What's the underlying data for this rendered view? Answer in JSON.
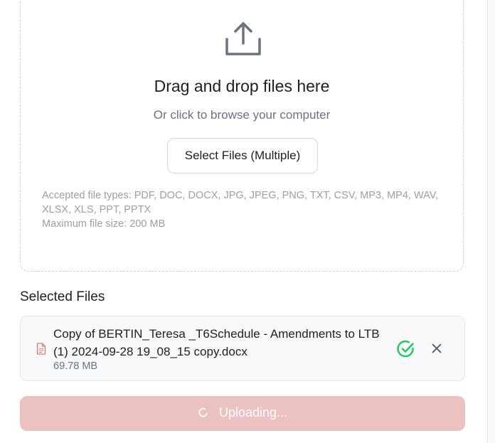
{
  "dropzone": {
    "title": "Drag and drop files here",
    "subtitle": "Or click to browse your computer",
    "select_button_label": "Select Files (Multiple)",
    "accepted_types_line1": "Accepted file types: PDF, DOC, DOCX, JPG, JPEG, PNG, TXT, CSV, MP3, MP4, WAV,",
    "accepted_types_line2": "XLSX, XLS, PPT, PPTX",
    "max_size": "Maximum file size: 200 MB",
    "icon": "upload-icon"
  },
  "selected_files": {
    "title": "Selected Files",
    "files": [
      {
        "name": "Copy of BERTIN_Teresa _T6Schedule - Amendments to LTB (1) 2024-09-28 19_08_15 copy.docx",
        "size": "69.78 MB",
        "status": "complete",
        "icons": [
          "document-icon",
          "check-circle-icon",
          "close-icon"
        ]
      }
    ]
  },
  "upload_button": {
    "label": "Uploading...",
    "state": "disabled",
    "icon": "spinner-icon"
  },
  "colors": {
    "accent_disabled": "#ecc1c1",
    "success": "#22c55e",
    "doc_icon": "#e07a7a"
  }
}
